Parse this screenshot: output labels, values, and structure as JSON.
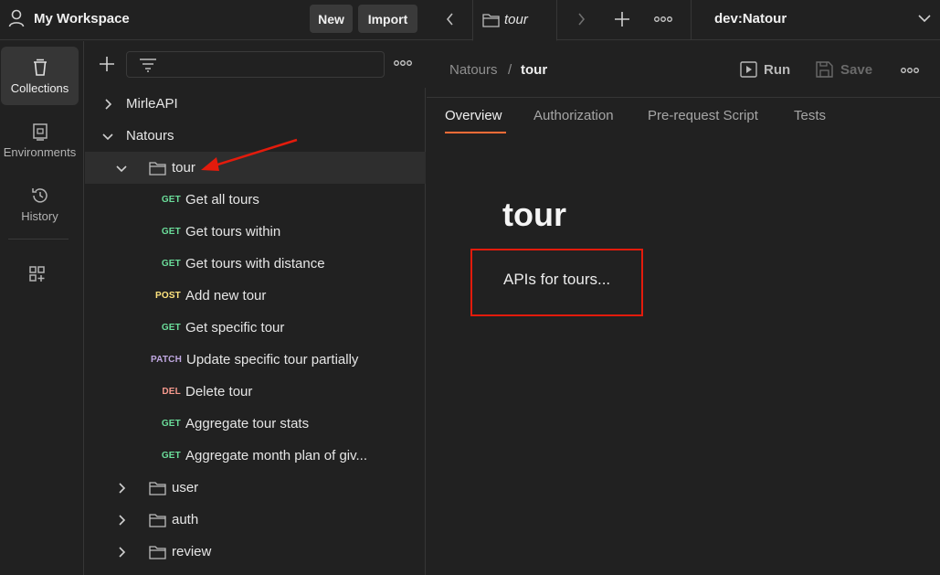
{
  "workspace": {
    "title": "My Workspace",
    "new_label": "New",
    "import_label": "Import"
  },
  "rail": {
    "items": [
      {
        "label": "Collections",
        "icon": "trash-can-collections-icon"
      },
      {
        "label": "Environments",
        "icon": "environment-icon"
      },
      {
        "label": "History",
        "icon": "history-icon"
      }
    ]
  },
  "tree": {
    "collections": [
      {
        "name": "MirleAPI"
      },
      {
        "name": "Natours"
      }
    ],
    "folder_open": "tour",
    "requests": [
      {
        "method": "GET",
        "label": "Get all tours"
      },
      {
        "method": "GET",
        "label": "Get tours within"
      },
      {
        "method": "GET",
        "label": "Get tours with distance"
      },
      {
        "method": "POST",
        "label": "Add new tour"
      },
      {
        "method": "GET",
        "label": "Get specific tour"
      },
      {
        "method": "PATCH",
        "label": "Update specific tour partially"
      },
      {
        "method": "DEL",
        "label": "Delete tour"
      },
      {
        "method": "GET",
        "label": "Aggregate tour stats"
      },
      {
        "method": "GET",
        "label": "Aggregate month plan of giv..."
      }
    ],
    "folders": [
      {
        "name": "user"
      },
      {
        "name": "auth"
      },
      {
        "name": "review"
      }
    ]
  },
  "tabbar": {
    "tab_label": "tour",
    "environment": "dev:Natour"
  },
  "request": {
    "breadcrumb_parent": "Natours",
    "breadcrumb_sep": "/",
    "breadcrumb_current": "tour",
    "run_label": "Run",
    "save_label": "Save"
  },
  "subtabs": [
    "Overview",
    "Authorization",
    "Pre-request Script",
    "Tests"
  ],
  "overview": {
    "title": "tour",
    "description": "APIs for tours..."
  },
  "colors": {
    "accent": "#ff6c37",
    "annotation": "#e31b0c",
    "get": "#6bdd9a",
    "post": "#ffe47e",
    "patch": "#c0a8e1",
    "delete": "#f79a8e"
  }
}
